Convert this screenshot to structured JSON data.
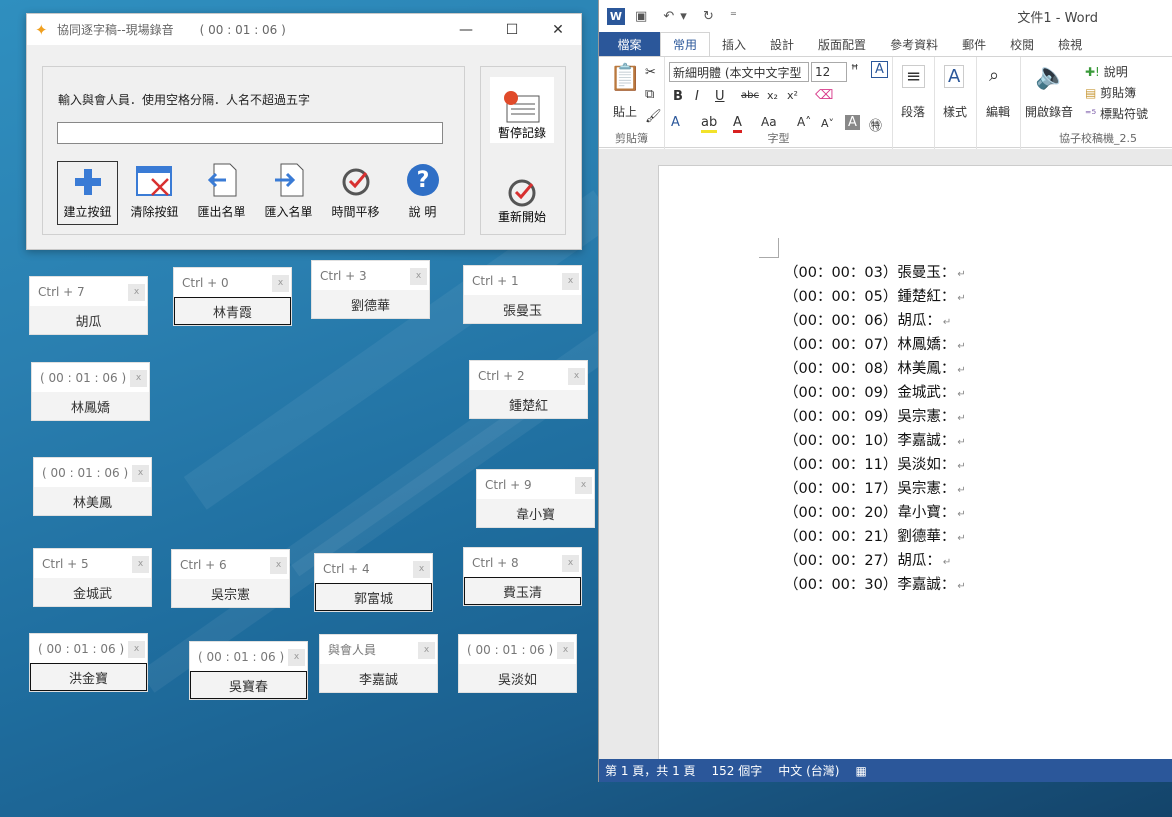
{
  "app": {
    "title": "協同逐字稿--現場錄音",
    "time": "( 00 : 01 : 06 )",
    "minimize": "—",
    "maximize": "☐",
    "close": "✕",
    "input_label": "輸入與會人員．使用空格分隔．人名不超過五字",
    "input_value": "",
    "tools": [
      {
        "label": "建立按鈕",
        "icon": "plus-icon"
      },
      {
        "label": "清除按鈕",
        "icon": "clear-window-icon"
      },
      {
        "label": "匯出名單",
        "icon": "export-icon"
      },
      {
        "label": "匯入名單",
        "icon": "import-icon"
      },
      {
        "label": "時間平移",
        "icon": "time-shift-icon"
      },
      {
        "label": "說 明",
        "icon": "help-icon"
      }
    ],
    "pause_label": "暫停記錄",
    "restart_label": "重新開始"
  },
  "name_buttons": [
    {
      "top": "Ctrl + 7",
      "name": "胡瓜"
    },
    {
      "top": "Ctrl + 0",
      "name": "林青霞"
    },
    {
      "top": "Ctrl + 3",
      "name": "劉德華"
    },
    {
      "top": "Ctrl + 1",
      "name": "張曼玉"
    },
    {
      "top": "( 00 : 01 : 06 )",
      "name": "林鳳嬌"
    },
    {
      "top": "Ctrl + 2",
      "name": "鍾楚紅"
    },
    {
      "top": "( 00 : 01 : 06 )",
      "name": "林美鳳"
    },
    {
      "top": "Ctrl + 9",
      "name": "韋小寶"
    },
    {
      "top": "Ctrl + 5",
      "name": "金城武"
    },
    {
      "top": "Ctrl + 6",
      "name": "吳宗憲"
    },
    {
      "top": "Ctrl + 4",
      "name": "郭富城"
    },
    {
      "top": "Ctrl + 8",
      "name": "費玉清"
    },
    {
      "top": "( 00 : 01 : 06 )",
      "name": "洪金寶"
    },
    {
      "top": "( 00 : 01 : 06 )",
      "name": "吳寶春"
    },
    {
      "top": "與會人員",
      "name": "李嘉誠"
    },
    {
      "top": "( 00 : 01 : 06 )",
      "name": "吳淡如"
    }
  ],
  "word": {
    "doc_title": "文件1 - Word",
    "tabs": [
      "檔案",
      "常用",
      "插入",
      "設計",
      "版面配置",
      "參考資料",
      "郵件",
      "校閱",
      "檢視"
    ],
    "font_name": "新細明體 (本文中文字型",
    "font_size": "12",
    "groups": {
      "clipboard": "剪貼簿",
      "paste": "貼上",
      "font": "字型",
      "paragraph": "段落",
      "styles": "樣式",
      "editing": "編輯",
      "record": "開啟錄音",
      "help": "說明",
      "clip": "剪貼簿",
      "mark": "標點符號",
      "addin": "協子校稿機_2.5"
    },
    "lines": [
      "（00：00：03）張曼玉：",
      "（00：00：05）鍾楚紅：",
      "（00：00：06）胡瓜：",
      "（00：00：07）林鳳嬌：",
      "（00：00：08）林美鳳：",
      "（00：00：09）金城武：",
      "（00：00：09）吳宗憲：",
      "（00：00：10）李嘉誠：",
      "（00：00：11）吳淡如：",
      "（00：00：17）吳宗憲：",
      "（00：00：20）韋小寶：",
      "（00：00：21）劉德華：",
      "（00：00：27）胡瓜：",
      "（00：00：30）李嘉誠："
    ],
    "status": {
      "page": "第 1 頁，共 1 頁",
      "words": "152 個字",
      "lang": "中文 (台灣)"
    }
  }
}
